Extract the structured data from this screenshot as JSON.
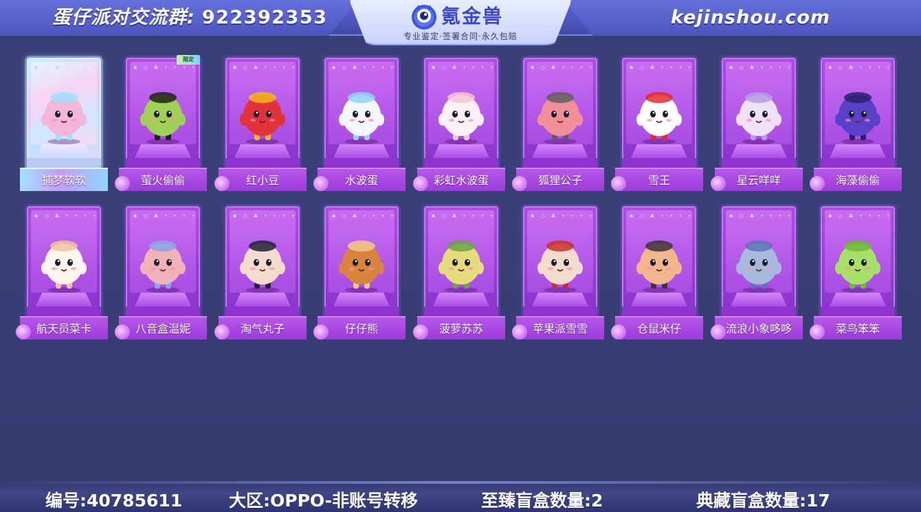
{
  "header": {
    "group_label": "蛋仔派对交流群:",
    "group_number": "922392353",
    "logo_name": "氪金兽",
    "logo_slogan": "专业鉴定·签署合同·永久包赔",
    "site_url": "kejinshou.com"
  },
  "items": [
    {
      "name": "捕梦软软",
      "tag": "",
      "color": "#f4b6d8",
      "accent": "#9ee0ff",
      "special": true
    },
    {
      "name": "萤火偷偷",
      "tag": "限定",
      "color": "#9fcf57",
      "accent": "#1e2214",
      "special": false
    },
    {
      "name": "红小豆",
      "tag": "",
      "color": "#e2333a",
      "accent": "#f5b51c",
      "special": false
    },
    {
      "name": "水波蛋",
      "tag": "",
      "color": "#f4f7ff",
      "accent": "#8fd3f6",
      "special": false
    },
    {
      "name": "彩虹水波蛋",
      "tag": "",
      "color": "#fbf1f4",
      "accent": "#f5c4d6",
      "special": false
    },
    {
      "name": "狐狸公子",
      "tag": "",
      "color": "#f08f98",
      "accent": "#5e5e66",
      "special": false
    },
    {
      "name": "雪王",
      "tag": "",
      "color": "#ffffff",
      "accent": "#e32b2b",
      "special": false
    },
    {
      "name": "星云咩咩",
      "tag": "",
      "color": "#efe2f6",
      "accent": "#b79ae8",
      "special": false
    },
    {
      "name": "海藻偷偷",
      "tag": "",
      "color": "#5a3fc8",
      "accent": "#2a1f6a",
      "special": false
    },
    {
      "name": "航天员菜卡",
      "tag": "",
      "color": "#fff7ee",
      "accent": "#f2c2a0",
      "special": false
    },
    {
      "name": "八音盒温妮",
      "tag": "",
      "color": "#f1b1b8",
      "accent": "#8aa6e6",
      "special": false
    },
    {
      "name": "淘气丸子",
      "tag": "",
      "color": "#f3dccb",
      "accent": "#23203a",
      "special": false
    },
    {
      "name": "仔仔熊",
      "tag": "",
      "color": "#d9843e",
      "accent": "#f3c890",
      "special": false
    },
    {
      "name": "菠萝苏苏",
      "tag": "",
      "color": "#e6dc7e",
      "accent": "#6aa246",
      "special": false
    },
    {
      "name": "苹果派雪雪",
      "tag": "",
      "color": "#f3dccb",
      "accent": "#c7302c",
      "special": false
    },
    {
      "name": "仓鼠米仔",
      "tag": "",
      "color": "#f2b58c",
      "accent": "#3a3340",
      "special": false
    },
    {
      "name": "流浪小象哆哆",
      "tag": "",
      "color": "#a7b9dc",
      "accent": "#5d73b8",
      "special": false
    },
    {
      "name": "菜鸟笨笨",
      "tag": "",
      "color": "#a8e06a",
      "accent": "#6fb93a",
      "special": false
    }
  ],
  "footer": {
    "id_text": "编号:40785611",
    "region_text": "大区:OPPO-非账号转移",
    "premium_text": "至臻盲盒数量:2",
    "collection_text": "典藏盲盒数量:17"
  }
}
